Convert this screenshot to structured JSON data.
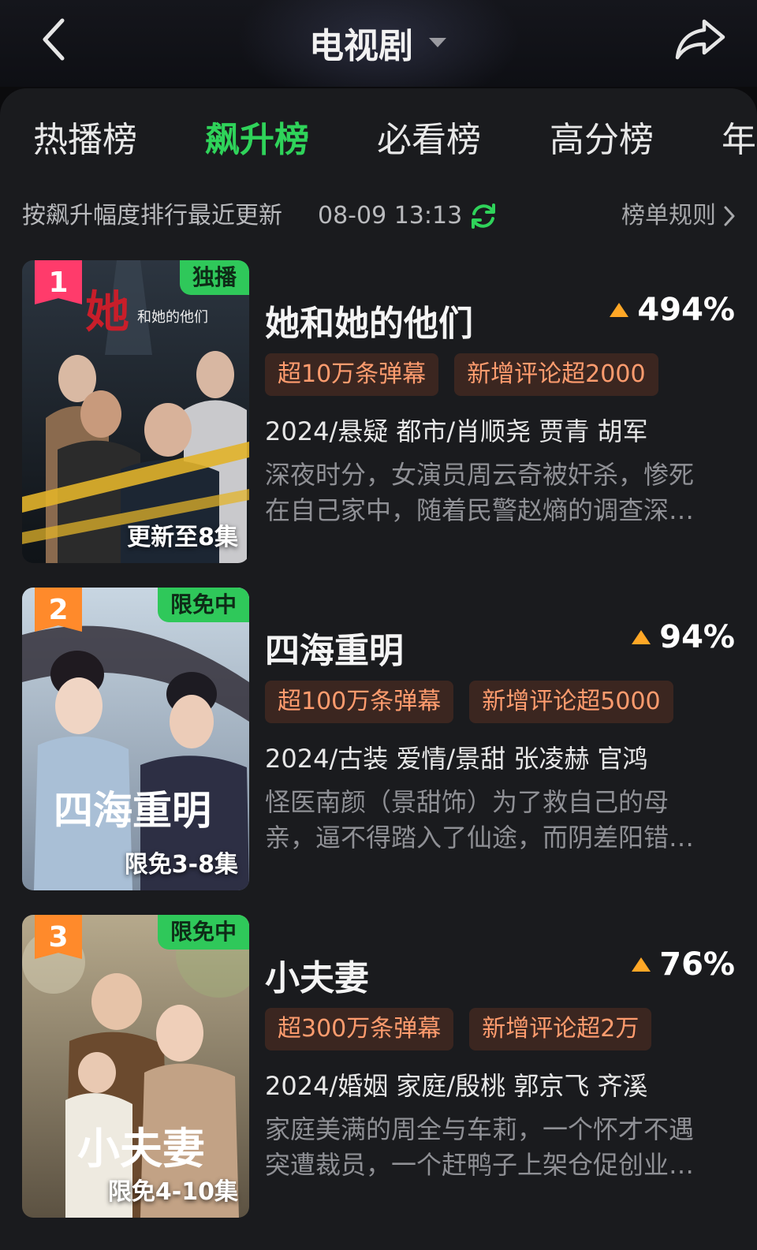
{
  "header": {
    "title": "电视剧"
  },
  "tabs": [
    {
      "label": "热播榜",
      "active": false
    },
    {
      "label": "飙升榜",
      "active": true
    },
    {
      "label": "必看榜",
      "active": false
    },
    {
      "label": "高分榜",
      "active": false
    },
    {
      "label": "年",
      "active": false
    }
  ],
  "subbar": {
    "sort_text": "按飙升幅度排行最近更新",
    "update_time": "08-09 13:13",
    "rules_label": "榜单规则"
  },
  "colors": {
    "accent": "#2fd35a",
    "tag_text": "#ff9c6e",
    "trend_arrow": "#ffa726",
    "rank1": "#ff3b6b",
    "rank_other": "#ff8a2b"
  },
  "items": [
    {
      "rank": "1",
      "badge": "独播",
      "poster_label": "更新至8集",
      "poster_title": "她",
      "title": "她和她的他们",
      "trend": "494%",
      "tags": [
        "超10万条弹幕",
        "新增评论超2000"
      ],
      "meta": "2024/悬疑 都市/肖顺尧 贾青 胡军",
      "desc_lines": [
        "深夜时分，女演员周云奇被奸杀，惨死",
        "在自己家中，随着民警赵熵的调查深…"
      ]
    },
    {
      "rank": "2",
      "badge": "限免中",
      "poster_label": "限免3-8集",
      "poster_title": "四海重明",
      "title": "四海重明",
      "trend": "94%",
      "tags": [
        "超100万条弹幕",
        "新增评论超5000"
      ],
      "meta": "2024/古装 爱情/景甜 张凌赫 官鸿",
      "desc_lines": [
        "怪医南颜（景甜饰）为了救自己的母",
        "亲，逼不得踏入了仙途，而阴差阳错…"
      ]
    },
    {
      "rank": "3",
      "badge": "限免中",
      "poster_label": "限免4-10集",
      "poster_title": "小夫妻",
      "title": "小夫妻",
      "trend": "76%",
      "tags": [
        "超300万条弹幕",
        "新增评论超2万"
      ],
      "meta": "2024/婚姻 家庭/殷桃 郭京飞 齐溪",
      "desc_lines": [
        "家庭美满的周全与车莉，一个怀才不遇",
        "突遭裁员，一个赶鸭子上架仓促创业…"
      ]
    }
  ]
}
